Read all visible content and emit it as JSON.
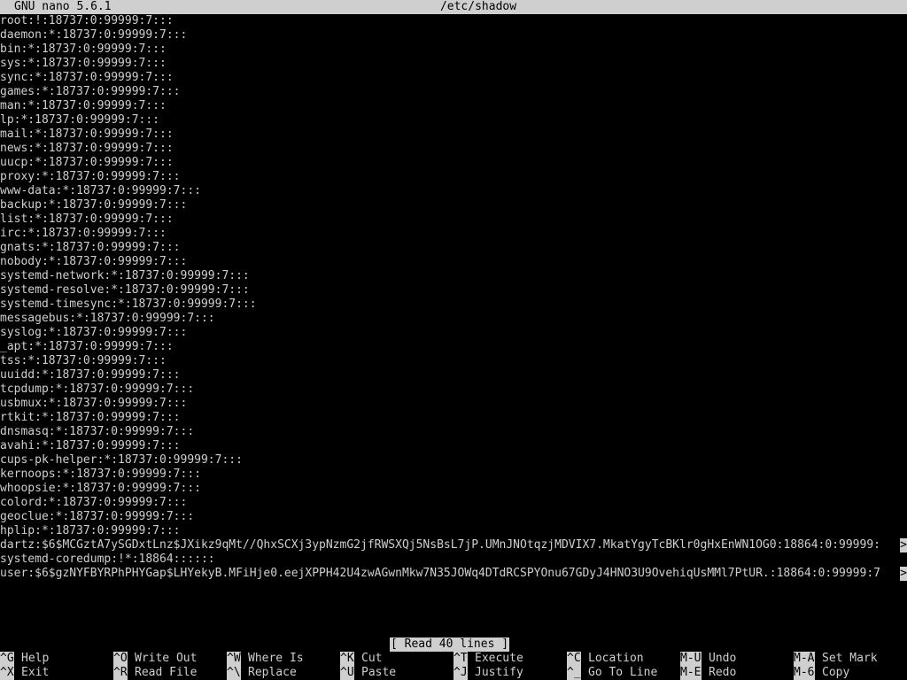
{
  "titlebar": {
    "app_name": "GNU nano 5.6.1",
    "file_name": "/etc/shadow"
  },
  "lines": [
    "root:!:18737:0:99999:7:::",
    "daemon:*:18737:0:99999:7:::",
    "bin:*:18737:0:99999:7:::",
    "sys:*:18737:0:99999:7:::",
    "sync:*:18737:0:99999:7:::",
    "games:*:18737:0:99999:7:::",
    "man:*:18737:0:99999:7:::",
    "lp:*:18737:0:99999:7:::",
    "mail:*:18737:0:99999:7:::",
    "news:*:18737:0:99999:7:::",
    "uucp:*:18737:0:99999:7:::",
    "proxy:*:18737:0:99999:7:::",
    "www-data:*:18737:0:99999:7:::",
    "backup:*:18737:0:99999:7:::",
    "list:*:18737:0:99999:7:::",
    "irc:*:18737:0:99999:7:::",
    "gnats:*:18737:0:99999:7:::",
    "nobody:*:18737:0:99999:7:::",
    "systemd-network:*:18737:0:99999:7:::",
    "systemd-resolve:*:18737:0:99999:7:::",
    "systemd-timesync:*:18737:0:99999:7:::",
    "messagebus:*:18737:0:99999:7:::",
    "syslog:*:18737:0:99999:7:::",
    "_apt:*:18737:0:99999:7:::",
    "tss:*:18737:0:99999:7:::",
    "uuidd:*:18737:0:99999:7:::",
    "tcpdump:*:18737:0:99999:7:::",
    "usbmux:*:18737:0:99999:7:::",
    "rtkit:*:18737:0:99999:7:::",
    "dnsmasq:*:18737:0:99999:7:::",
    "avahi:*:18737:0:99999:7:::",
    "cups-pk-helper:*:18737:0:99999:7:::",
    "kernoops:*:18737:0:99999:7:::",
    "whoopsie:*:18737:0:99999:7:::",
    "colord:*:18737:0:99999:7:::",
    "geoclue:*:18737:0:99999:7:::",
    "hplip:*:18737:0:99999:7:::",
    "dartz:$6$MCGztA7ySGDxtLnz$JXikz9qMt//QhxSCXj3ypNzmG2jfRWSXQj5NsBsL7jP.UMnJNOtqzjMDVIX7.MkatYgyTcBKlr0gHxEnWN1OG0:18864:0:99999:",
    "systemd-coredump:!*:18864::::::",
    "user:$6$gzNYFBYRPhPHYGap$LHYekyB.MFiHje0.eejXPPH42U4zwAGwnMkw7N35JOWq4DTdRCSPYOnu67GDyJ4HNO3U9OvehiqUsMMl7PtUR.:18864:0:99999:7"
  ],
  "truncated_marker": ">",
  "status_message": "[ Read 40 lines ]",
  "shortcuts_row1": [
    {
      "key": "^G",
      "label": "Help"
    },
    {
      "key": "^O",
      "label": "Write Out"
    },
    {
      "key": "^W",
      "label": "Where Is"
    },
    {
      "key": "^K",
      "label": "Cut"
    },
    {
      "key": "^T",
      "label": "Execute"
    },
    {
      "key": "^C",
      "label": "Location"
    },
    {
      "key": "M-U",
      "label": "Undo"
    },
    {
      "key": "M-A",
      "label": "Set Mark"
    }
  ],
  "shortcuts_row2": [
    {
      "key": "^X",
      "label": "Exit"
    },
    {
      "key": "^R",
      "label": "Read File"
    },
    {
      "key": "^\\",
      "label": "Replace"
    },
    {
      "key": "^U",
      "label": "Paste"
    },
    {
      "key": "^J",
      "label": "Justify"
    },
    {
      "key": "^_",
      "label": "Go To Line"
    },
    {
      "key": "M-E",
      "label": "Redo"
    },
    {
      "key": "M-6",
      "label": "Copy"
    }
  ],
  "colors": {
    "background": "#000000",
    "foreground": "#cfcfcf",
    "inverse_bg": "#cfcfcf",
    "inverse_fg": "#000000"
  }
}
